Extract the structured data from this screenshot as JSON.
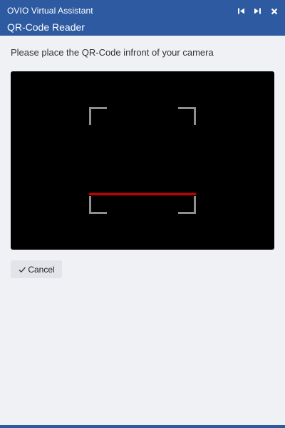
{
  "window": {
    "app_title": "OVIO Virtual Assistant",
    "page_title": "QR-Code Reader",
    "accent_color": "#2d5aa0",
    "controls": [
      {
        "icon": "skip-back-icon"
      },
      {
        "icon": "skip-forward-icon"
      },
      {
        "icon": "close-icon"
      }
    ]
  },
  "main": {
    "instruction": "Please place the QR-Code infront of your camera",
    "scanner": {
      "background": "#000000",
      "frame_color": "#8f8f8f",
      "scan_line_color": "#d40000"
    }
  },
  "actions": {
    "cancel_label": "Cancel",
    "cancel_icon": "check-icon"
  }
}
